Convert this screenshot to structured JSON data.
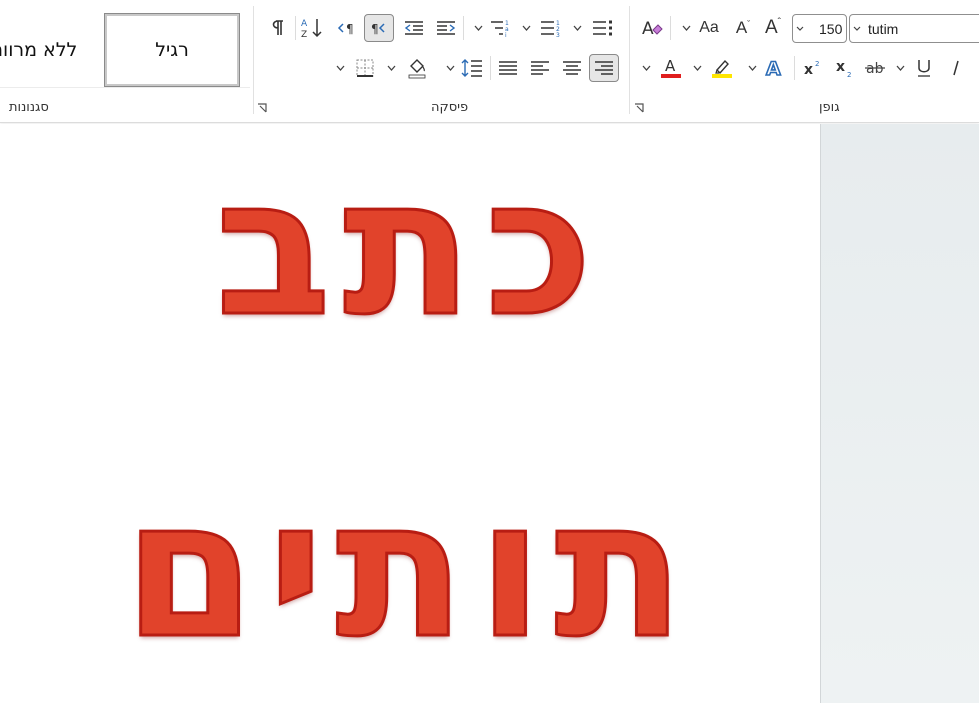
{
  "ribbon": {
    "groups": {
      "font": {
        "label": "גופן"
      },
      "paragraph": {
        "label": "פיסקה"
      },
      "styles": {
        "label": "סגנונות"
      }
    },
    "font": {
      "name": "tutim",
      "size": "150",
      "grow_label": "A",
      "shrink_label": "A",
      "change_case_label": "Aa",
      "clear_format_icon": "clear-formatting-icon",
      "text_effects_icon": "text-effects-icon",
      "highlight_color": "#ffe600",
      "font_color": "#e01e1e",
      "underline_label": "U",
      "italic_label": "I",
      "strike_label": "ab",
      "subscript_label": "x",
      "superscript_label": "x"
    },
    "styles": {
      "items": [
        {
          "label": "רגיל",
          "selected": true
        },
        {
          "label": "ללא מרווח",
          "selected": false
        }
      ]
    }
  },
  "document": {
    "line1": "כתב",
    "line2": "תותים",
    "letter_color": "#e1432b"
  }
}
